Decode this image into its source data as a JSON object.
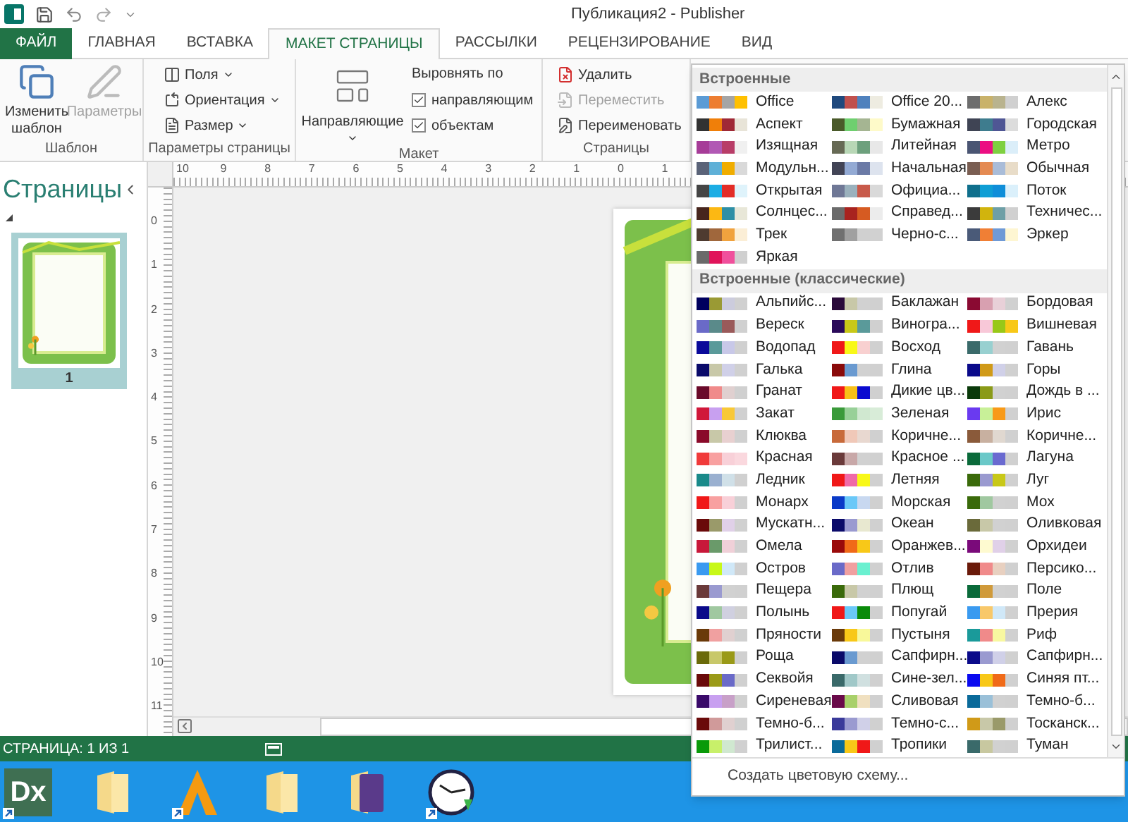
{
  "title_bar": {
    "title": "Публикация2 - Publisher"
  },
  "tabs": [
    {
      "label": "ФАЙЛ",
      "kind": "file",
      "selected": false
    },
    {
      "label": "ГЛАВНАЯ",
      "kind": "tab",
      "selected": false
    },
    {
      "label": "ВСТАВКА",
      "kind": "tab",
      "selected": false
    },
    {
      "label": "МАКЕТ СТРАНИЦЫ",
      "kind": "tab",
      "selected": true
    },
    {
      "label": "РАССЫЛКИ",
      "kind": "tab",
      "selected": false
    },
    {
      "label": "РЕЦЕНЗИРОВАНИЕ",
      "kind": "tab",
      "selected": false
    },
    {
      "label": "ВИД",
      "kind": "tab",
      "selected": false
    }
  ],
  "ribbon": {
    "template": {
      "label": "Шаблон",
      "buttons": [
        {
          "label": "Изменить шаблон",
          "disabled": false
        },
        {
          "label": "Параметры",
          "disabled": true
        }
      ]
    },
    "page_setup": {
      "label": "Параметры страницы",
      "items": [
        "Поля",
        "Ориентация",
        "Размер"
      ]
    },
    "layout": {
      "label": "Макет",
      "guides": "Направляющие",
      "align_label": "Выровнять по",
      "checks": [
        {
          "label": "направляющим",
          "checked": true
        },
        {
          "label": "объектам",
          "checked": true
        }
      ]
    },
    "pages": {
      "label": "Страницы",
      "buttons": [
        {
          "label": "Удалить",
          "disabled": false
        },
        {
          "label": "Переместить",
          "disabled": true
        },
        {
          "label": "Переименовать",
          "disabled": false
        }
      ]
    }
  },
  "pages_pane": {
    "title": "Страницы",
    "pages": [
      {
        "number": "1",
        "selected": true
      }
    ]
  },
  "rulers": {
    "horizontal": [
      "10",
      "9",
      "8",
      "7",
      "6",
      "5",
      "4",
      "3",
      "2",
      "1",
      "0",
      "1"
    ],
    "vertical": [
      "0",
      "1",
      "2",
      "3",
      "4",
      "5",
      "6",
      "7",
      "8",
      "9",
      "10",
      "11"
    ]
  },
  "color_menu": {
    "sections": [
      {
        "title": "Встроенные",
        "schemes": [
          {
            "name": "Office",
            "swatches": [
              {
                "color": "#5b9bd5"
              },
              {
                "color": "#ed7d31"
              },
              {
                "color": "#a5a5a5"
              },
              {
                "color": "#ffc000"
              }
            ]
          },
          {
            "name": "Office 20...",
            "swatches": [
              {
                "color": "#1f497d"
              },
              {
                "color": "#c0504d"
              },
              {
                "color": "#4f81bd"
              },
              {
                "color": "#eeece1"
              }
            ]
          },
          {
            "name": "Алекс",
            "swatches": [
              {
                "color": "#6d6d6d"
              },
              {
                "color": "#c9b26a"
              },
              {
                "color": "#b9b38e"
              },
              {
                "color": "#d0d0d0"
              }
            ]
          },
          {
            "name": "Аспект",
            "swatches": [
              {
                "color": "#323232"
              },
              {
                "color": "#f07f09"
              },
              {
                "color": "#9f2936"
              },
              {
                "color": "#e8e4d8"
              }
            ]
          },
          {
            "name": "Бумажная",
            "swatches": [
              {
                "color": "#4a5a2a"
              },
              {
                "color": "#6fcf6f"
              },
              {
                "color": "#a5b592"
              },
              {
                "color": "#fefac9"
              }
            ]
          },
          {
            "name": "Городская",
            "swatches": [
              {
                "color": "#3f4454"
              },
              {
                "color": "#3e7c8e"
              },
              {
                "color": "#4f5694"
              },
              {
                "color": "#dcdcdc"
              }
            ]
          },
          {
            "name": "Изящная",
            "swatches": [
              {
                "color": "#a63c98"
              },
              {
                "color": "#b159b4"
              },
              {
                "color": "#b83d68"
              },
              {
                "color": "#f0f0f0"
              }
            ]
          },
          {
            "name": "Литейная",
            "swatches": [
              {
                "color": "#676a55"
              },
              {
                "color": "#b8d7b6"
              },
              {
                "color": "#6da07d"
              },
              {
                "color": "#e8e8e8"
              }
            ]
          },
          {
            "name": "Метро",
            "swatches": [
              {
                "color": "#4a5573"
              },
              {
                "color": "#eb0e82"
              },
              {
                "color": "#7ed040"
              },
              {
                "color": "#dbeef9"
              }
            ]
          },
          {
            "name": "Модульн...",
            "swatches": [
              {
                "color": "#5a6378"
              },
              {
                "color": "#5fb0d7"
              },
              {
                "color": "#f0ad00"
              },
              {
                "color": "#d9d9d9"
              }
            ]
          },
          {
            "name": "Начальная",
            "swatches": [
              {
                "color": "#424456"
              },
              {
                "color": "#93aad4"
              },
              {
                "color": "#6b7aa6"
              },
              {
                "color": "#dde3ee"
              }
            ]
          },
          {
            "name": "Обычная",
            "swatches": [
              {
                "color": "#7a5e52"
              },
              {
                "color": "#e48a52"
              },
              {
                "color": "#a9bcd8"
              },
              {
                "color": "#e8dcc8"
              }
            ]
          },
          {
            "name": "Открытая",
            "swatches": [
              {
                "color": "#454545"
              },
              {
                "color": "#1cade4"
              },
              {
                "color": "#e32d27"
              },
              {
                "color": "#dff3fb"
              }
            ]
          },
          {
            "name": "Официа...",
            "swatches": [
              {
                "color": "#6f7896"
              },
              {
                "color": "#9ab1bd"
              },
              {
                "color": "#c85a4a"
              },
              {
                "color": "#d9d9d9"
              }
            ]
          },
          {
            "name": "Поток",
            "swatches": [
              {
                "color": "#0f6f8c"
              },
              {
                "color": "#0f9ed5"
              },
              {
                "color": "#0f8ed9"
              },
              {
                "color": "#dbf0fb"
              }
            ]
          },
          {
            "name": "Солнцес...",
            "swatches": [
              {
                "color": "#47261d"
              },
              {
                "color": "#fcb813"
              },
              {
                "color": "#2e8fa5"
              },
              {
                "color": "#e8e7d8"
              }
            ]
          },
          {
            "name": "Справед...",
            "swatches": [
              {
                "color": "#6b6b6b"
              },
              {
                "color": "#a8231f"
              },
              {
                "color": "#d65b22"
              },
              {
                "color": "#ececec"
              }
            ]
          },
          {
            "name": "Техничес...",
            "swatches": [
              {
                "color": "#3b3b3b"
              },
              {
                "color": "#d1b40d"
              },
              {
                "color": "#6e9fa6"
              },
              {
                "color": "#d0d0d0"
              }
            ]
          },
          {
            "name": "Трек",
            "swatches": [
              {
                "color": "#4e3b30"
              },
              {
                "color": "#a0673c"
              },
              {
                "color": "#f0a23e"
              },
              {
                "color": "#fbeed6"
              }
            ]
          },
          {
            "name": "Черно-с...",
            "swatches": [
              {
                "color": "#707070"
              },
              {
                "color": "#a0a0a0"
              },
              {
                "color": "#d0d0d0"
              },
              {
                "color": "#d1d1d1"
              }
            ]
          },
          {
            "name": "Эркер",
            "swatches": [
              {
                "color": "#4a5a78"
              },
              {
                "color": "#f07f35"
              },
              {
                "color": "#6f9ad6"
              },
              {
                "color": "#fef6d2"
              }
            ]
          },
          {
            "name": "Яркая",
            "swatches": [
              {
                "color": "#6a6a6a"
              },
              {
                "color": "#e0145a"
              },
              {
                "color": "#f0509c"
              },
              {
                "color": "#d0d0d0"
              }
            ]
          }
        ]
      },
      {
        "title": "Встроенные (классические)",
        "schemes": [
          {
            "name": "Альпийс...",
            "swatches": [
              {
                "color": "#00005e"
              },
              {
                "color": "#9a9a34"
              },
              {
                "color": "#ccccdd"
              },
              {
                "color": "#d0d0d0"
              }
            ]
          },
          {
            "name": "Баклажан",
            "swatches": [
              {
                "color": "#2a0a3a"
              },
              {
                "color": "#c8c8a8"
              },
              {
                "color": "#d1d1d1"
              },
              {
                "color": "#d0d0d0"
              }
            ]
          },
          {
            "name": "Бордовая",
            "swatches": [
              {
                "color": "#8a0a32"
              },
              {
                "color": "#d8a0b0"
              },
              {
                "color": "#e8d0d8"
              },
              {
                "color": "#d0d0d0"
              }
            ]
          },
          {
            "name": "Вереск",
            "swatches": [
              {
                "color": "#6a6ac8"
              },
              {
                "color": "#5a8a8a"
              },
              {
                "color": "#9a5a5a"
              },
              {
                "color": "#d0d0d0"
              }
            ]
          },
          {
            "name": "Виногра...",
            "swatches": [
              {
                "color": "#2a0a5a"
              },
              {
                "color": "#c8c818"
              },
              {
                "color": "#5a9a9a"
              },
              {
                "color": "#d0d0d0"
              }
            ]
          },
          {
            "name": "Вишневая",
            "swatches": [
              {
                "color": "#f01818"
              },
              {
                "color": "#f8c8d8"
              },
              {
                "color": "#98c818"
              },
              {
                "color": "#f8c818"
              }
            ]
          },
          {
            "name": "Водопад",
            "swatches": [
              {
                "color": "#0a0a9a"
              },
              {
                "color": "#5a9a9a"
              },
              {
                "color": "#c8c8e8"
              },
              {
                "color": "#d0d0d0"
              }
            ]
          },
          {
            "name": "Восход",
            "swatches": [
              {
                "color": "#f01818"
              },
              {
                "color": "#f8f818"
              },
              {
                "color": "#f8d0d0"
              },
              {
                "color": "#d0d0d0"
              }
            ]
          },
          {
            "name": "Гавань",
            "swatches": [
              {
                "color": "#3a6a6a"
              },
              {
                "color": "#98d0d0"
              },
              {
                "color": "#d1d1d1"
              },
              {
                "color": "#d0d0d0"
              }
            ]
          },
          {
            "name": "Галька",
            "swatches": [
              {
                "color": "#0a0a6a"
              },
              {
                "color": "#c8c8a8"
              },
              {
                "color": "#d0d0e8"
              },
              {
                "color": "#d0d0d0"
              }
            ]
          },
          {
            "name": "Глина",
            "swatches": [
              {
                "color": "#8a0a0a"
              },
              {
                "color": "#6a9ad0"
              },
              {
                "color": "#d1d1d1"
              },
              {
                "color": "#d0d0d0"
              }
            ]
          },
          {
            "name": "Горы",
            "swatches": [
              {
                "color": "#0a0a8a"
              },
              {
                "color": "#d09a18"
              },
              {
                "color": "#d0d0e8"
              },
              {
                "color": "#d0d0d0"
              }
            ]
          },
          {
            "name": "Гранат",
            "swatches": [
              {
                "color": "#6a0a2a"
              },
              {
                "color": "#f08a8a"
              },
              {
                "color": "#e0d0d0"
              },
              {
                "color": "#d0d0d0"
              }
            ]
          },
          {
            "name": "Дикие цв...",
            "swatches": [
              {
                "color": "#f01818"
              },
              {
                "color": "#f8c018"
              },
              {
                "color": "#0a0ad0"
              },
              {
                "color": "#d0d0d0"
              }
            ]
          },
          {
            "name": "Дождь в ...",
            "swatches": [
              {
                "color": "#0a3a0a"
              },
              {
                "color": "#8a9a18"
              },
              {
                "color": "#d1d1d1"
              },
              {
                "color": "#d0d0d0"
              }
            ]
          },
          {
            "name": "Закат",
            "swatches": [
              {
                "color": "#d0183a"
              },
              {
                "color": "#c8a0f0"
              },
              {
                "color": "#f8c838"
              },
              {
                "color": "#d0d0d0"
              }
            ]
          },
          {
            "name": "Зеленая",
            "swatches": [
              {
                "color": "#3a9a3a"
              },
              {
                "color": "#98d098"
              },
              {
                "color": "#d0e8d0"
              },
              {
                "color": "#d8ecd8"
              }
            ]
          },
          {
            "name": "Ирис",
            "swatches": [
              {
                "color": "#6a3af0"
              },
              {
                "color": "#c8f098"
              },
              {
                "color": "#f89a18"
              },
              {
                "color": "#d0d0d0"
              }
            ]
          },
          {
            "name": "Клюква",
            "swatches": [
              {
                "color": "#8a0a2a"
              },
              {
                "color": "#c8c8a8"
              },
              {
                "color": "#e8d0d0"
              },
              {
                "color": "#d0d0d0"
              }
            ]
          },
          {
            "name": "Коричне...",
            "swatches": [
              {
                "color": "#c86a3a"
              },
              {
                "color": "#f0c8b8"
              },
              {
                "color": "#e8d8d0"
              },
              {
                "color": "#d0d0d0"
              }
            ]
          },
          {
            "name": "Коричне...",
            "swatches": [
              {
                "color": "#8a5a3a"
              },
              {
                "color": "#c8b0a0"
              },
              {
                "color": "#e0d8d0"
              },
              {
                "color": "#d0d0d0"
              }
            ]
          },
          {
            "name": "Красная",
            "swatches": [
              {
                "color": "#f03a3a"
              },
              {
                "color": "#f8a0a0"
              },
              {
                "color": "#f8d0d8"
              },
              {
                "color": "#fad8de"
              }
            ]
          },
          {
            "name": "Красное ...",
            "swatches": [
              {
                "color": "#6a3a3a"
              },
              {
                "color": "#c8a8a8"
              },
              {
                "color": "#d1d1d1"
              },
              {
                "color": "#d0d0d0"
              }
            ]
          },
          {
            "name": "Лагуна",
            "swatches": [
              {
                "color": "#0a6a3a"
              },
              {
                "color": "#6ac8c8"
              },
              {
                "color": "#6a6ad0"
              },
              {
                "color": "#d0d0d0"
              }
            ]
          },
          {
            "name": "Ледник",
            "swatches": [
              {
                "color": "#1a8a8a"
              },
              {
                "color": "#9ab0d0"
              },
              {
                "color": "#d0e0e8"
              },
              {
                "color": "#d0d0d0"
              }
            ]
          },
          {
            "name": "Летняя",
            "swatches": [
              {
                "color": "#f01818"
              },
              {
                "color": "#f06aa8"
              },
              {
                "color": "#f8f818"
              },
              {
                "color": "#d0d0d0"
              }
            ]
          },
          {
            "name": "Луг",
            "swatches": [
              {
                "color": "#3a6a0a"
              },
              {
                "color": "#9a9ad0"
              },
              {
                "color": "#c8c818"
              },
              {
                "color": "#d0d0d0"
              }
            ]
          },
          {
            "name": "Монарх",
            "swatches": [
              {
                "color": "#f01818"
              },
              {
                "color": "#f8a0a0"
              },
              {
                "color": "#f8d0d8"
              },
              {
                "color": "#d0d0d0"
              }
            ]
          },
          {
            "name": "Морская",
            "swatches": [
              {
                "color": "#0a3ac8"
              },
              {
                "color": "#6ac8f8"
              },
              {
                "color": "#c8d8f0"
              },
              {
                "color": "#d0d0d0"
              }
            ]
          },
          {
            "name": "Мох",
            "swatches": [
              {
                "color": "#3a6a0a"
              },
              {
                "color": "#a0c8a0"
              },
              {
                "color": "#d1d1d1"
              },
              {
                "color": "#d0d0d0"
              }
            ]
          },
          {
            "name": "Мускатн...",
            "swatches": [
              {
                "color": "#6a0a0a"
              },
              {
                "color": "#9a9a6a"
              },
              {
                "color": "#e0d0e8"
              },
              {
                "color": "#d0d0d0"
              }
            ]
          },
          {
            "name": "Океан",
            "swatches": [
              {
                "color": "#0a0a6a"
              },
              {
                "color": "#9a9ad0"
              },
              {
                "color": "#e8e8d0"
              },
              {
                "color": "#d0d0d0"
              }
            ]
          },
          {
            "name": "Оливковая",
            "swatches": [
              {
                "color": "#6a6a3a"
              },
              {
                "color": "#c8c8a8"
              },
              {
                "color": "#d1d1d1"
              },
              {
                "color": "#d0d0d0"
              }
            ]
          },
          {
            "name": "Омела",
            "swatches": [
              {
                "color": "#c8183a"
              },
              {
                "color": "#6a9a6a"
              },
              {
                "color": "#f0d0d8"
              },
              {
                "color": "#d0d0d0"
              }
            ]
          },
          {
            "name": "Оранжев...",
            "swatches": [
              {
                "color": "#9a0a0a"
              },
              {
                "color": "#f06a18"
              },
              {
                "color": "#f8c818"
              },
              {
                "color": "#d0d0d0"
              }
            ]
          },
          {
            "name": "Орхидеи",
            "swatches": [
              {
                "color": "#7a0a7a"
              },
              {
                "color": "#fefad0"
              },
              {
                "color": "#e0d0e8"
              },
              {
                "color": "#d0d0d0"
              }
            ]
          },
          {
            "name": "Остров",
            "swatches": [
              {
                "color": "#3a9af0"
              },
              {
                "color": "#c8f818"
              },
              {
                "color": "#d0e8f8"
              },
              {
                "color": "#d0d0d0"
              }
            ]
          },
          {
            "name": "Отлив",
            "swatches": [
              {
                "color": "#6a6ac8"
              },
              {
                "color": "#f0a0a0"
              },
              {
                "color": "#6af0d0"
              },
              {
                "color": "#d0d0d0"
              }
            ]
          },
          {
            "name": "Персико...",
            "swatches": [
              {
                "color": "#6a1a0a"
              },
              {
                "color": "#f08a8a"
              },
              {
                "color": "#e8d0c0"
              },
              {
                "color": "#d0d0d0"
              }
            ]
          },
          {
            "name": "Пещера",
            "swatches": [
              {
                "color": "#6a3a3a"
              },
              {
                "color": "#9a9ad0"
              },
              {
                "color": "#d1d1d1"
              },
              {
                "color": "#d0d0d0"
              }
            ]
          },
          {
            "name": "Плющ",
            "swatches": [
              {
                "color": "#3a6a0a"
              },
              {
                "color": "#c8c8a8"
              },
              {
                "color": "#d1d1d1"
              },
              {
                "color": "#d0d0d0"
              }
            ]
          },
          {
            "name": "Поле",
            "swatches": [
              {
                "color": "#0a6a3a"
              },
              {
                "color": "#d09a3a"
              },
              {
                "color": "#d1d1d1"
              },
              {
                "color": "#d0d0d0"
              }
            ]
          },
          {
            "name": "Полынь",
            "swatches": [
              {
                "color": "#0a0a8a"
              },
              {
                "color": "#a0c8a0"
              },
              {
                "color": "#d0d0e0"
              },
              {
                "color": "#d0d0d0"
              }
            ]
          },
          {
            "name": "Попугай",
            "swatches": [
              {
                "color": "#f01818"
              },
              {
                "color": "#6ac8f8"
              },
              {
                "color": "#0a8a0a"
              },
              {
                "color": "#d0d0d0"
              }
            ]
          },
          {
            "name": "Прерия",
            "swatches": [
              {
                "color": "#3a9af0"
              },
              {
                "color": "#f8c86a"
              },
              {
                "color": "#d0e8f8"
              },
              {
                "color": "#d0d0d0"
              }
            ]
          },
          {
            "name": "Пряности",
            "swatches": [
              {
                "color": "#6a3a0a"
              },
              {
                "color": "#f0a0a0"
              },
              {
                "color": "#e0d0d0"
              },
              {
                "color": "#d0d0d0"
              }
            ]
          },
          {
            "name": "Пустыня",
            "swatches": [
              {
                "color": "#6a3a0a"
              },
              {
                "color": "#f8c818"
              },
              {
                "color": "#f8f89a"
              },
              {
                "color": "#d0d0d0"
              }
            ]
          },
          {
            "name": "Риф",
            "swatches": [
              {
                "color": "#1a9a9a"
              },
              {
                "color": "#f08a8a"
              },
              {
                "color": "#f8f8a0"
              },
              {
                "color": "#d0d0d0"
              }
            ]
          },
          {
            "name": "Роща",
            "swatches": [
              {
                "color": "#6a6a0a"
              },
              {
                "color": "#c8c86a"
              },
              {
                "color": "#9a9a18"
              },
              {
                "color": "#d0d0d0"
              }
            ]
          },
          {
            "name": "Сапфирн...",
            "swatches": [
              {
                "color": "#0a0a6a"
              },
              {
                "color": "#6a9ad0"
              },
              {
                "color": "#d1d1d1"
              },
              {
                "color": "#d0d0d0"
              }
            ]
          },
          {
            "name": "Сапфирн...",
            "swatches": [
              {
                "color": "#0a0a8a"
              },
              {
                "color": "#9a9ad0"
              },
              {
                "color": "#d0d0e8"
              },
              {
                "color": "#d0d0d0"
              }
            ]
          },
          {
            "name": "Секвойя",
            "swatches": [
              {
                "color": "#6a0a0a"
              },
              {
                "color": "#9a9a18"
              },
              {
                "color": "#6a6ac8"
              },
              {
                "color": "#d0d0d0"
              }
            ]
          },
          {
            "name": "Сине-зел...",
            "swatches": [
              {
                "color": "#3a6a6a"
              },
              {
                "color": "#a0c8c8"
              },
              {
                "color": "#d0e0e0"
              },
              {
                "color": "#d0d0d0"
              }
            ]
          },
          {
            "name": "Синяя пт...",
            "swatches": [
              {
                "color": "#0a0af0"
              },
              {
                "color": "#f8c818"
              },
              {
                "color": "#f06a18"
              },
              {
                "color": "#d0d0d0"
              }
            ]
          },
          {
            "name": "Сиреневая",
            "swatches": [
              {
                "color": "#3a0a6a"
              },
              {
                "color": "#c8a0f0"
              },
              {
                "color": "#c8a0c8"
              },
              {
                "color": "#d0d0d0"
              }
            ]
          },
          {
            "name": "Сливовая",
            "swatches": [
              {
                "color": "#6a0a4a"
              },
              {
                "color": "#a8d06a"
              },
              {
                "color": "#f0e0c0"
              },
              {
                "color": "#d0d0d0"
              }
            ]
          },
          {
            "name": "Темно-б...",
            "swatches": [
              {
                "color": "#0a6a9a"
              },
              {
                "color": "#9ac0d8"
              },
              {
                "color": "#d1d1d1"
              },
              {
                "color": "#d0d0d0"
              }
            ]
          },
          {
            "name": "Темно-б...",
            "swatches": [
              {
                "color": "#6a0a0a"
              },
              {
                "color": "#d09a9a"
              },
              {
                "color": "#e0d0d0"
              },
              {
                "color": "#d0d0d0"
              }
            ]
          },
          {
            "name": "Темно-с...",
            "swatches": [
              {
                "color": "#3a3a9a"
              },
              {
                "color": "#9a9ad0"
              },
              {
                "color": "#d0d0e8"
              },
              {
                "color": "#d0d0d0"
              }
            ]
          },
          {
            "name": "Тосканск...",
            "swatches": [
              {
                "color": "#d09a18"
              },
              {
                "color": "#c8c8a8"
              },
              {
                "color": "#9a9a6a"
              },
              {
                "color": "#d0d0d0"
              }
            ]
          },
          {
            "name": "Трилист...",
            "swatches": [
              {
                "color": "#0a9a0a"
              },
              {
                "color": "#c8f06a"
              },
              {
                "color": "#d0e8d0"
              },
              {
                "color": "#d0d0d0"
              }
            ]
          },
          {
            "name": "Тропики",
            "swatches": [
              {
                "color": "#0a6a9a"
              },
              {
                "color": "#f8c818"
              },
              {
                "color": "#f01818"
              },
              {
                "color": "#d0d0d0"
              }
            ]
          },
          {
            "name": "Туман",
            "swatches": [
              {
                "color": "#3a6a6a"
              },
              {
                "color": "#c8c8a0"
              },
              {
                "color": "#d1d1d1"
              },
              {
                "color": "#d0d0d0"
              }
            ]
          }
        ]
      }
    ],
    "footer": "Создать цветовую схему..."
  },
  "status_bar": {
    "page": "СТРАНИЦА: 1 ИЗ 1"
  },
  "taskbar": {
    "icons": [
      {
        "kind": "dx",
        "label": "Dx",
        "shortcut": true
      },
      {
        "kind": "folder",
        "shortcut": false
      },
      {
        "kind": "a-app",
        "shortcut": true
      },
      {
        "kind": "folder",
        "shortcut": false
      },
      {
        "kind": "purple-folder",
        "shortcut": false
      },
      {
        "kind": "clock",
        "shortcut": true
      }
    ]
  }
}
